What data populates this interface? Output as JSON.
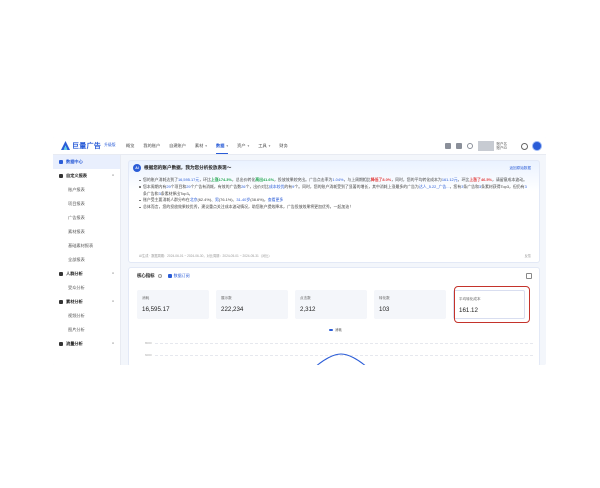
{
  "header": {
    "logo_text": "巨量广告",
    "logo_badge": "升级版",
    "nav": [
      {
        "label": "概览",
        "caret": false
      },
      {
        "label": "我的账户",
        "caret": false
      },
      {
        "label": "自建账户",
        "caret": false
      },
      {
        "label": "素材",
        "caret": true
      },
      {
        "label": "数据",
        "caret": true,
        "active": true
      },
      {
        "label": "资产",
        "caret": true
      },
      {
        "label": "工具",
        "caret": true
      },
      {
        "label": "财务",
        "caret": false
      }
    ],
    "account_line1": "账户名",
    "account_line2": "账户ID"
  },
  "sidebar": {
    "items": [
      {
        "label": "数据中心",
        "type": "active"
      },
      {
        "label": "自定义报表",
        "type": "group",
        "caret": "^"
      },
      {
        "label": "账户报表",
        "type": "child"
      },
      {
        "label": "项目报表",
        "type": "child"
      },
      {
        "label": "广告报表",
        "type": "child"
      },
      {
        "label": "素材报表",
        "type": "child"
      },
      {
        "label": "基础素材报表",
        "type": "child"
      },
      {
        "label": "全部报表",
        "type": "child"
      },
      {
        "label": "人群分析",
        "type": "group",
        "caret": "^"
      },
      {
        "label": "受众分析",
        "type": "child"
      },
      {
        "label": "素材分析",
        "type": "group",
        "caret": "^"
      },
      {
        "label": "视频分析",
        "type": "child"
      },
      {
        "label": "图片分析",
        "type": "child"
      },
      {
        "label": "流量分析",
        "type": "group",
        "caret": "^"
      }
    ]
  },
  "ai_card": {
    "badge": "AI",
    "title": "根据您的账户数据，我为您分析投放表现～",
    "link": "返回原始数据",
    "bullets": [
      {
        "parts": [
          {
            "t": "您的账户消耗达到了",
            "c": ""
          },
          {
            "t": "16,595.17元",
            "c": "b"
          },
          {
            "t": "，环比",
            "c": ""
          },
          {
            "t": "上涨174.3%",
            "c": "g"
          },
          {
            "t": "，总出价转化",
            "c": ""
          },
          {
            "t": "高出41.6%",
            "c": "g"
          },
          {
            "t": "，投放效果较突出。广告点击率为",
            "c": ""
          },
          {
            "t": "1.04%",
            "c": "b"
          },
          {
            "t": "，与上周期相比",
            "c": ""
          },
          {
            "t": "降低了8.0%",
            "c": "r"
          },
          {
            "t": "，同时，您的平均转化成本为",
            "c": ""
          },
          {
            "t": "161.12元",
            "c": "b"
          },
          {
            "t": "，环比",
            "c": ""
          },
          {
            "t": "上涨了46.5%",
            "c": "r"
          },
          {
            "t": "，请留意成本波动。",
            "c": ""
          }
        ]
      },
      {
        "parts": [
          {
            "t": "您本周期内有",
            "c": ""
          },
          {
            "t": "29",
            "c": "b"
          },
          {
            "t": "个项目和",
            "c": ""
          },
          {
            "t": "29",
            "c": "b"
          },
          {
            "t": "个广告有消耗，有效的广告数",
            "c": ""
          },
          {
            "t": "26",
            "c": "b"
          },
          {
            "t": "个，出价对比",
            "c": ""
          },
          {
            "t": "成本较优",
            "c": "b"
          },
          {
            "t": "的有",
            "c": ""
          },
          {
            "t": "9",
            "c": "b"
          },
          {
            "t": "个。同时，您的账户消耗受到了显著的增长，其中消耗上涨最多的广告为",
            "c": ""
          },
          {
            "t": "达人_5.22_广告...",
            "c": "b"
          },
          {
            "t": "，您有",
            "c": ""
          },
          {
            "t": "3",
            "c": "b"
          },
          {
            "t": "条广告和",
            "c": ""
          },
          {
            "t": "3",
            "c": "b"
          },
          {
            "t": "条素材获得Top3，但仍有",
            "c": ""
          },
          {
            "t": "3",
            "c": "b"
          },
          {
            "t": "条广告和",
            "c": ""
          },
          {
            "t": "3",
            "c": "b"
          },
          {
            "t": "条素材掉出Top3。",
            "c": ""
          }
        ]
      },
      {
        "parts": [
          {
            "t": "账户受主要消耗人群分布在",
            "c": ""
          },
          {
            "t": "北京",
            "c": "b"
          },
          {
            "t": "(62.4%)、",
            "c": ""
          },
          {
            "t": "男",
            "c": "b"
          },
          {
            "t": "(76.1%)、",
            "c": ""
          },
          {
            "t": "31-40岁",
            "c": "b"
          },
          {
            "t": "(38.6%)，",
            "c": ""
          },
          {
            "t": "查看更多",
            "c": "b"
          }
        ]
      },
      {
        "parts": [
          {
            "t": "总体而言，您的投放效果较优秀，建议重点关注成本波动情况，助您账户提效降本，广告投放效果将更加优秀，一起加油！",
            "c": ""
          }
        ]
      }
    ],
    "footer": "AI生成 · 数据周期：2024-06-01 ~ 2024-06-30，对比周期：2024-05-01 ~ 2024-05-31（对比）",
    "footer_right": "反馈"
  },
  "metrics": {
    "title": "核心指标",
    "subscribe": "数据订阅",
    "tiles": [
      {
        "label": "消耗",
        "value": "16,595.17"
      },
      {
        "label": "展示数",
        "value": "222,234"
      },
      {
        "label": "点击数",
        "value": "2,312"
      },
      {
        "label": "转化数",
        "value": "103"
      },
      {
        "label": "平均转化成本",
        "value": "161.12",
        "highlight": true
      }
    ],
    "legend": "消耗",
    "y_ticks": [
      "8000",
      "6000",
      "4000"
    ]
  },
  "colors": {
    "accent": "#2a5cd7",
    "up": "#1ea54f",
    "down": "#e03c3c",
    "focus": "#c4332b"
  }
}
